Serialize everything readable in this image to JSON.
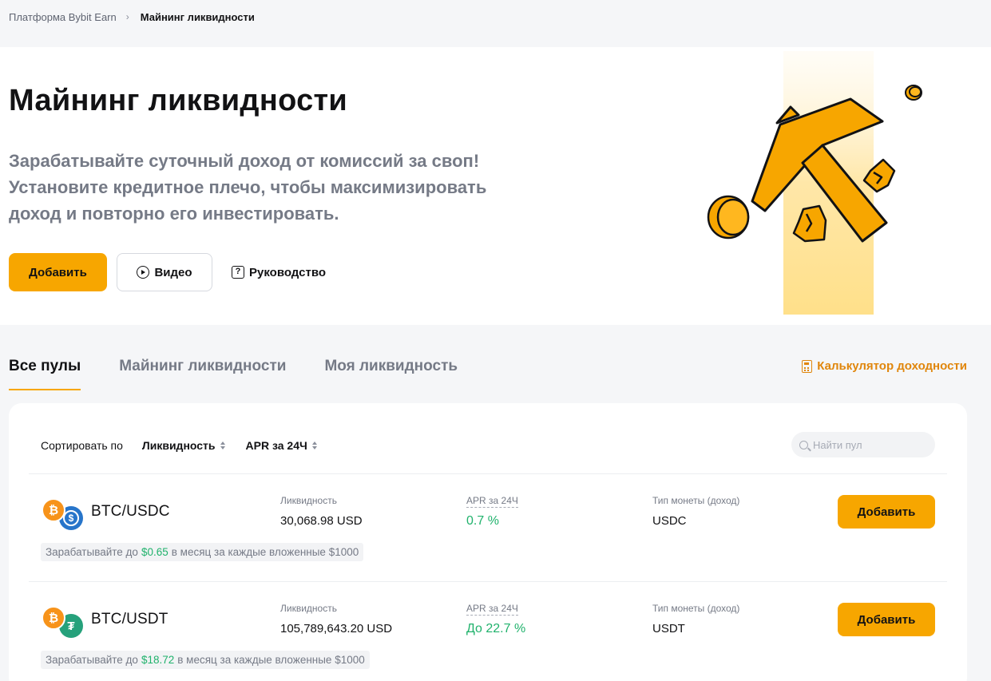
{
  "breadcrumb": {
    "parent": "Платформа Bybit Earn",
    "current": "Майнинг ликвидности"
  },
  "hero": {
    "title": "Майнинг ликвидности",
    "subtitle_lines": [
      "Зарабатывайте суточный доход от комиссий за своп!",
      "Установите кредитное плечо, чтобы максимизировать",
      "доход и повторно его инвестировать."
    ],
    "add_label": "Добавить",
    "video_label": "Видео",
    "guide_label": "Руководство"
  },
  "tabs": [
    {
      "label": "Все пулы",
      "active": true
    },
    {
      "label": "Майнинг ликвидности",
      "active": false
    },
    {
      "label": "Моя ликвидность",
      "active": false
    }
  ],
  "calculator_label": "Калькулятор доходности",
  "sort": {
    "label": "Сортировать по",
    "options": [
      "Ликвидность",
      "APR за 24Ч"
    ]
  },
  "search": {
    "placeholder": "Найти пул"
  },
  "columns": {
    "liquidity": "Ликвидность",
    "apr": "APR за 24Ч",
    "coin_type": "Тип монеты (доход)"
  },
  "pools": [
    {
      "pair": "BTC/USDC",
      "base_icon": "bitcoin-icon",
      "quote_icon": "usdc-icon",
      "liquidity": "30,068.98 USD",
      "apr": "0.7 %",
      "coin": "USDC",
      "add_label": "Добавить",
      "earn_prefix": "Зарабатывайте до",
      "earn_amount": "$0.65",
      "earn_suffix": "в месяц за каждые вложенные $1000"
    },
    {
      "pair": "BTC/USDT",
      "base_icon": "bitcoin-icon",
      "quote_icon": "tether-icon",
      "liquidity": "105,789,643.20 USD",
      "apr": "До 22.7 %",
      "coin": "USDT",
      "add_label": "Добавить",
      "earn_prefix": "Зарабатывайте до",
      "earn_amount": "$18.72",
      "earn_suffix": "в месяц за каждые вложенные $1000"
    }
  ],
  "colors": {
    "accent": "#f7a600",
    "positive": "#20b26c",
    "link": "#e0860c"
  }
}
